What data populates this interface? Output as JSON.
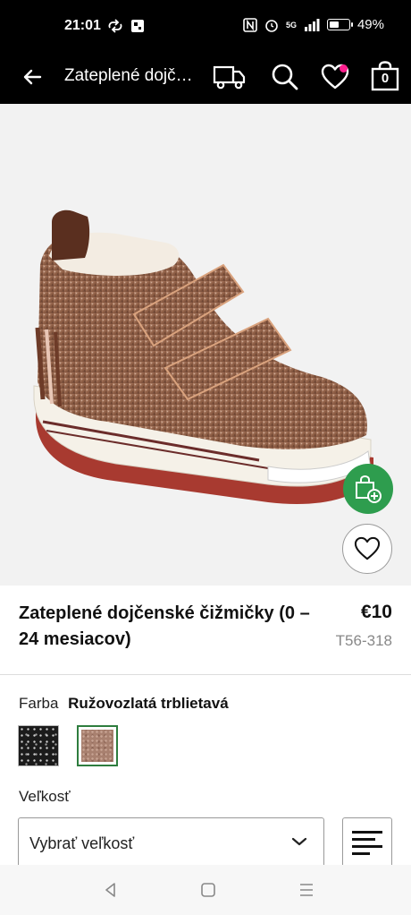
{
  "status_bar": {
    "time": "21:01",
    "battery": "49%",
    "battery_level": 0.49,
    "network": "5G",
    "icons": [
      "sync-icon",
      "notification-icon",
      "nfc-icon",
      "alarm-icon",
      "signal-icon",
      "battery-icon"
    ]
  },
  "header": {
    "title": "Zateplené dojčenské čižmičky (0 – 24 mesiacov)",
    "bag_count": "0",
    "icons": [
      "back-arrow-icon",
      "delivery-truck-icon",
      "search-icon",
      "heart-icon",
      "shopping-bag-icon"
    ],
    "favorite_dot_color": "#ff1f8e"
  },
  "gallery": {
    "image": "baby-bootie-rose-gold-glitter",
    "dots": [
      {
        "active": false
      },
      {
        "active": true
      },
      {
        "active": false
      },
      {
        "active": false
      },
      {
        "active": false
      },
      {
        "active": false
      }
    ],
    "quick_add_color": "#2e9d4e"
  },
  "product": {
    "name": "Zateplené dojčenské čižmičky (0 – 24 mesiacov)",
    "price": "€10",
    "sku": "T56-318"
  },
  "colour": {
    "label": "Farba",
    "selected": "Ružovozlatá trblietavá",
    "swatches": [
      {
        "name": "black-glitter",
        "color": "#1b1b1b",
        "selected": false
      },
      {
        "name": "rose-gold-glitter",
        "color": "#a8806f",
        "selected": true
      }
    ]
  },
  "size": {
    "label": "Veľkosť",
    "placeholder": "Vybrať veľkosť"
  },
  "nav": {
    "icons": [
      "nav-back-icon",
      "nav-home-icon",
      "nav-menu-icon"
    ]
  }
}
